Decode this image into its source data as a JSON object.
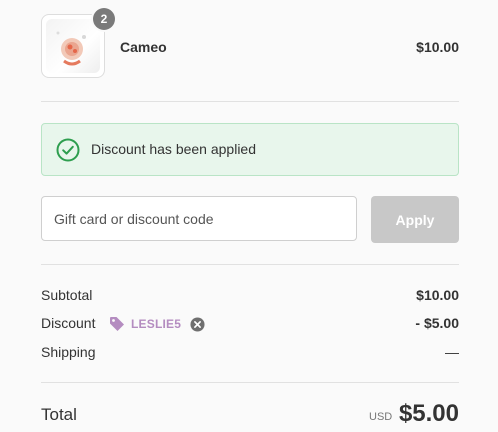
{
  "line_item": {
    "name": "Cameo",
    "price": "$10.00",
    "quantity": "2",
    "image_icon": "cameo-product-image"
  },
  "notice": {
    "text": "Discount has been applied",
    "icon": "check-circle-icon",
    "color": "#2e9e4f"
  },
  "discount_form": {
    "placeholder": "Gift card or discount code",
    "button_label": "Apply"
  },
  "summary": {
    "subtotal_label": "Subtotal",
    "subtotal_value": "$10.00",
    "discount_label": "Discount",
    "discount_code": "LESLIE5",
    "discount_value": "- $5.00",
    "shipping_label": "Shipping",
    "shipping_value": "—"
  },
  "total": {
    "label": "Total",
    "currency": "USD",
    "value": "$5.00"
  },
  "colors": {
    "accent_tag": "#b48cc0",
    "notice_bg": "#e8f6ec",
    "button_disabled": "#c8c8c8"
  }
}
